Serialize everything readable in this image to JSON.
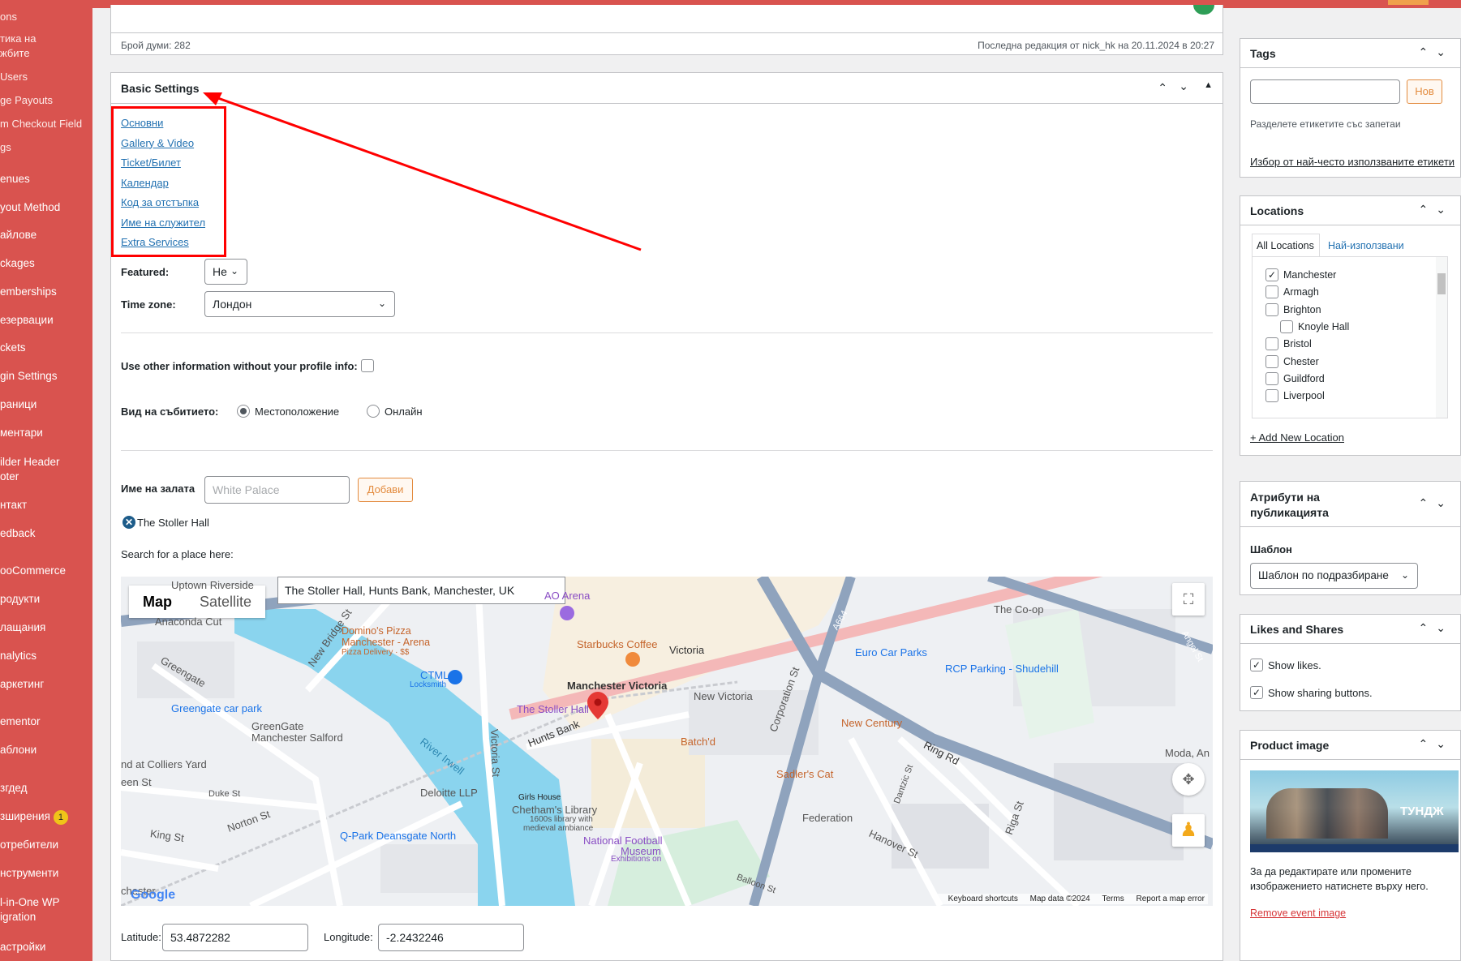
{
  "sidebar": {
    "items": [
      "ons",
      "тика на",
      "жбите",
      "Users",
      "ge Payouts",
      "m Checkout Field",
      "gs",
      "enues",
      "yout Method",
      "айлове",
      "ckages",
      "emberships",
      "езервации",
      "ckets",
      "gin Settings",
      "раници",
      "ментари",
      "ilder Header",
      "oter",
      "нтакт",
      "edback",
      "ooCommerce",
      "родукти",
      "лащания",
      "nalytics",
      "аркетинг",
      "ementor",
      "аблони",
      "згдед",
      "зширения",
      "отребители",
      "нструменти",
      "l-in-One WP",
      "igration",
      "астройки"
    ],
    "badge": "1"
  },
  "status": {
    "words": "Брой думи: 282",
    "last_edit": "Последна редакция от nick_hk на 20.11.2024 в 20:27"
  },
  "basic": {
    "title": "Basic Settings",
    "tabs": [
      "Основни",
      "Gallery & Video",
      "Ticket/Билет",
      "Календар",
      "Код за отстъпка",
      "Име на служител",
      "Extra Services"
    ],
    "featured_label": "Featured:",
    "featured_value": "Не",
    "timezone_label": "Time zone:",
    "timezone_value": "Лондон",
    "other_info_label": "Use other information without your profile info:",
    "event_type_label": "Вид на събитието:",
    "event_type_location": "Местоположение",
    "event_type_online": "Онлайн",
    "hall_label": "Име на залата",
    "hall_placeholder": "White Palace",
    "add_button": "Добави",
    "hall_item": "The Stoller Hall",
    "search_label": "Search for a place here:",
    "search_value": "The Stoller Hall, Hunts Bank, Manchester, UK",
    "lat_label": "Latitude:",
    "lat_value": "53.4872282",
    "lng_label": "Longitude:",
    "lng_value": "-2.2432246"
  },
  "map": {
    "type_map": "Map",
    "type_satellite": "Satellite",
    "labels": {
      "uptown": "Uptown Riverside",
      "anaconda": "Anaconda Cut",
      "dominos1": "Domino's Pizza",
      "dominos2": "Manchester - Arena",
      "dominos3": "Pizza Delivery · $$",
      "ao": "AO Arena",
      "starbucks": "Starbucks Coffee",
      "victoria": "Victoria",
      "ctml1": "CTML",
      "ctml2": "Locksmith",
      "man_victoria": "Manchester Victoria",
      "stoller": "The Stoller Hall",
      "new_victoria": "New Victoria",
      "greengate_park": "Greengate car park",
      "greengate1": "GreenGate",
      "greengate2": "Manchester Salford",
      "hunts_bank": "Hunts Bank",
      "batchd": "Batch'd",
      "new_century": "New Century",
      "euro_car": "Euro Car Parks",
      "rcp": "RCP Parking - Shudehill",
      "coop": "The Co-op",
      "river": "River Irwell",
      "colliers": "nd at Colliers Yard",
      "deloitte": "Deloitte LLP",
      "girls_house": "Girls House",
      "chetham1": "Chetham's Library",
      "chetham2": "1600s library with",
      "chetham3": "medieval ambiance",
      "sadlers": "Sadler's Cat",
      "moda": "Moda, An",
      "federation": "Federation",
      "qpark": "Q-Park Deansgate North",
      "nfm1": "National Football",
      "nfm2": "Museum",
      "nfm3": "Exhibitions on",
      "king_st": "King St",
      "norton_st": "Norton St",
      "duke_st": "Duke St",
      "green_st": "een St",
      "greengate_st": "Greengate",
      "new_bridge": "New Bridge St",
      "victoria_st": "Victoria St",
      "corporation": "Corporation St",
      "ring_rd": "Ring Rd",
      "hanover": "Hanover St",
      "a664": "A664",
      "angel": "Angel St",
      "riga": "Riga St",
      "dantzic": "Dantzic St",
      "balloon": "Balloon St",
      "google": "Google",
      "chester": "chester"
    },
    "attribution": [
      "Keyboard shortcuts",
      "Map data ©2024",
      "Terms",
      "Report a map error"
    ]
  },
  "right": {
    "tags_title": "Tags",
    "tags_add": "Нов",
    "tags_hint": "Разделете етикетите със запетаи",
    "tags_popular": "Избор от най-често използваните етикети",
    "loc_title": "Locations",
    "loc_tab_all": "All Locations",
    "loc_tab_popular": "Най-използвани",
    "locations": [
      {
        "name": "Manchester",
        "checked": true,
        "indent": false
      },
      {
        "name": "Armagh",
        "checked": false,
        "indent": false
      },
      {
        "name": "Brighton",
        "checked": false,
        "indent": false
      },
      {
        "name": "Knoyle Hall",
        "checked": false,
        "indent": true
      },
      {
        "name": "Bristol",
        "checked": false,
        "indent": false
      },
      {
        "name": "Chester",
        "checked": false,
        "indent": false
      },
      {
        "name": "Guildford",
        "checked": false,
        "indent": false
      },
      {
        "name": "Liverpool",
        "checked": false,
        "indent": false
      }
    ],
    "loc_add": "+ Add New Location",
    "attr_title": "Атрибути на публикацията",
    "attr_template_label": "Шаблон",
    "attr_template_value": "Шаблон по подразбиране",
    "likes_title": "Likes and Shares",
    "likes_show": "Show likes.",
    "likes_share": "Show sharing buttons.",
    "img_title": "Product image",
    "img_hint": "За да редактирате или промените изображението натиснете върху него.",
    "img_remove": "Remove event image",
    "poster_title": "ТУНДЖ"
  },
  "colors": {
    "sidebar": "#d9534f",
    "accent": "#2271b1",
    "highlight": "#ff0000",
    "orange": "#e38b3e"
  }
}
